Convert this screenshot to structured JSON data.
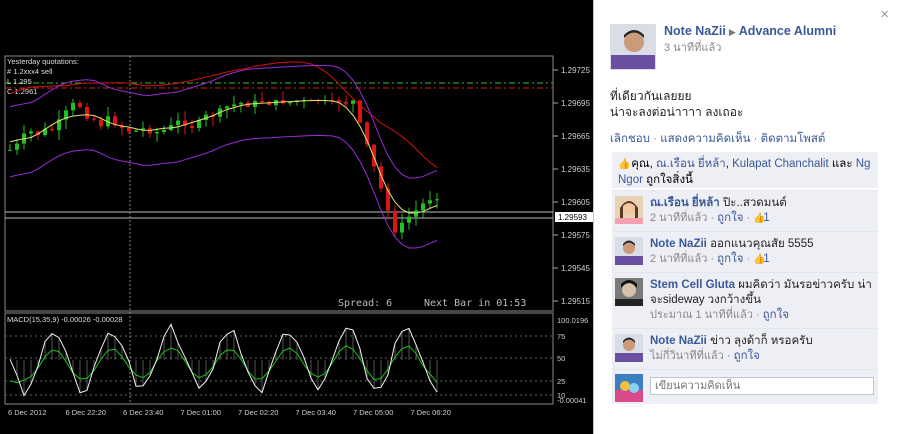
{
  "chart": {
    "info_lines": [
      "Yesterday quotations:",
      "# 1.2xxx4 sell",
      "L 1.295",
      "C 1.2961"
    ],
    "price_ticks": [
      "1.29725",
      "1.29695",
      "1.29665",
      "1.29635",
      "1.29605",
      "1.29575",
      "1.29545",
      "1.29515"
    ],
    "current_price": "1.29593",
    "spread_label": "Spread: 6",
    "next_bar_label": "Next Bar in 01:53",
    "macd_label": "MACD(15,35,9) -0.00026 -0.00028",
    "macd_ticks": [
      "100.0196",
      "75",
      "50",
      "25",
      "10",
      "-0.00041"
    ],
    "time_ticks": [
      "6 Dec 2012",
      "6 Dec 22:20",
      "6 Dec 23:40",
      "7 Dec 01:00",
      "7 Dec 02:20",
      "7 Dec 03:40",
      "7 Dec 05:00",
      "7 Dec 06:20"
    ],
    "colors": {
      "bull": "#22c028",
      "bear": "#d81818",
      "band": "#9a2bd6",
      "ma_red": "#d01010",
      "ma_yellow": "#e8e070",
      "macd": "#f0f0f0",
      "signal": "#20c020"
    }
  },
  "post": {
    "author": "Note NaZii",
    "arrow": "▶",
    "target": "Advance Alumni",
    "time": "3 นาทีที่แล้ว",
    "text_line1": "ที่เดียวกันเลยยย",
    "text_line2": "น่าจะลงต่อน่าาาา ลงเถอะ",
    "actions": {
      "unlike": "เลิกชอบ",
      "comment": "แสดงความคิดเห็น",
      "follow": "ติดตามโพสต์",
      "sep": " · "
    }
  },
  "likes": {
    "prefix": "คุณ,",
    "names": [
      "ณ.เรือน ยี่หล้า",
      "Kulapat Chanchalit"
    ],
    "and": "และ",
    "last": "Ng Ngor",
    "suffix": "ถูกใจสิ่งนี้"
  },
  "comments": [
    {
      "name": "ณ.เรือน ยี่หล้า",
      "text": "ปิะ..สวดมนต์",
      "time": "2 นาทีที่แล้ว",
      "like": "ถูกใจ",
      "count": "1"
    },
    {
      "name": "Note NaZii",
      "text": "ออกแนวคุณสัย 5555",
      "time": "2 นาทีที่แล้ว",
      "like": "ถูกใจ",
      "count": "1"
    },
    {
      "name": "Stem Cell Gluta",
      "text": "ผมคิดว่า มันรอข่าวครับ น่าจะsideway วงกว้างขึ้น",
      "time": "ประมาณ 1 นาทีที่แล้ว",
      "like": "ถูกใจ",
      "count": ""
    },
    {
      "name": "Note NaZii",
      "text": "ข่าว ลุงด้าก็ หรอครับ",
      "time": "ไม่กี่วินาทีที่แล้ว",
      "like": "ถูกใจ",
      "count": ""
    }
  ],
  "input": {
    "placeholder": "เขียนความคิดเห็น"
  },
  "ui": {
    "close": "×",
    "dot": "·",
    "like_icon": "👍"
  }
}
